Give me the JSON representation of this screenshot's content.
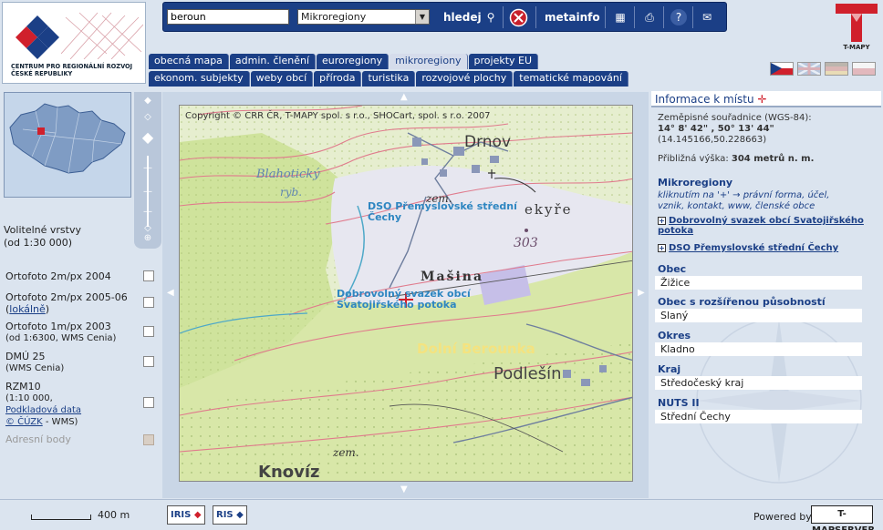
{
  "logo": {
    "line1": "CENTRUM PRO REGIONÁLNÍ ROZVOJ",
    "line2": "ČESKÉ REPUBLIKY"
  },
  "toolbar": {
    "search_value": "beroun",
    "select_value": "Mikroregiony",
    "search_label": "hledej",
    "metainfo_label": "metainfo"
  },
  "tmapy_logo": "T-MAPY",
  "tabs_row1": [
    "obecná mapa",
    "admin. členění",
    "euroregiony",
    "mikroregiony",
    "projekty EU"
  ],
  "tabs_row2": [
    "ekonom. subjekty",
    "weby obcí",
    "příroda",
    "turistika",
    "rozvojové plochy",
    "tematické mapování"
  ],
  "layers": {
    "title_line1": "Volitelné vrstvy",
    "title_line2": "(od 1:30 000)",
    "items": [
      {
        "label": "Ortofoto 2m/px 2004"
      },
      {
        "label": "Ortofoto 2m/px 2005-06",
        "sub": "(",
        "link": "lokálně",
        "sub2": ")"
      },
      {
        "label": "Ortofoto 1m/px 2003",
        "sub": "(od 1:6300, WMS Cenia)"
      },
      {
        "label": "DMÚ 25",
        "sub": "(WMS Cenia)"
      },
      {
        "label": "RZM10",
        "sub": "(1:10 000,",
        "link": "Podkladová data",
        "link2": "© ČÚZK",
        "sub2": " - WMS)"
      },
      {
        "label": "Adresní body"
      }
    ]
  },
  "map": {
    "copyright": "Copyright © CRR ČR, T-MAPY spol. s r.o., SHOCart, spol. s r.o. 2007",
    "labels": {
      "drnov": "Drnov",
      "blahoticky": "Blahotický",
      "ryb": "ryb.",
      "zem1": "zem.",
      "dso": "DSO Přemyslovské střední",
      "cechy": "Čechy",
      "ekyre": "ekyře",
      "elev": "303",
      "masina": "Mašina",
      "dobrovolny1": "Dobrovolný svazek obcí",
      "dobrovolny2": "Svatojiřského potoka",
      "dolni": "Dolní Berounka",
      "podlesin": "Podlešín",
      "zem2": "zem.",
      "knoviz": "Knovíz"
    }
  },
  "info": {
    "title": "Informace k místu",
    "coord_label": "Zeměpisné souřadnice (WGS-84):",
    "coord_dms": "14° 8' 42\" , 50° 13' 44\"",
    "coord_dec": "(14.145166,50.228663)",
    "height_label": "Přibližná výška:",
    "height_value": "304 metrů n. m.",
    "mikro_title": "Mikroregiony",
    "mikro_hint1": "kliknutím na '+' → právní forma, účel,",
    "mikro_hint2": "vznik, kontakt, www, členské obce",
    "mikro_item1a": "Dobrovolný svazek obcí Svatojiřského",
    "mikro_item1b": "potoka",
    "mikro_item2": "DSO Přemyslovské střední Čechy",
    "obec_label": "Obec",
    "obec_value": "Žižice",
    "orp_label": "Obec s rozšířenou působností",
    "orp_value": "Slaný",
    "okres_label": "Okres",
    "okres_value": "Kladno",
    "kraj_label": "Kraj",
    "kraj_value": "Středočeský kraj",
    "nuts_label": "NUTS II",
    "nuts_value": "Střední Čechy"
  },
  "bottom": {
    "scale": "400 m",
    "iris": "IRIS",
    "ris": "RIS",
    "powered": "Powered by",
    "tmapserver": "T-MAPSERVER"
  },
  "colors": {
    "navy": "#1b3f86",
    "panel": "#dbe4ef",
    "map_green": "#cfe39c",
    "map_red_line": "#e07a8c"
  }
}
